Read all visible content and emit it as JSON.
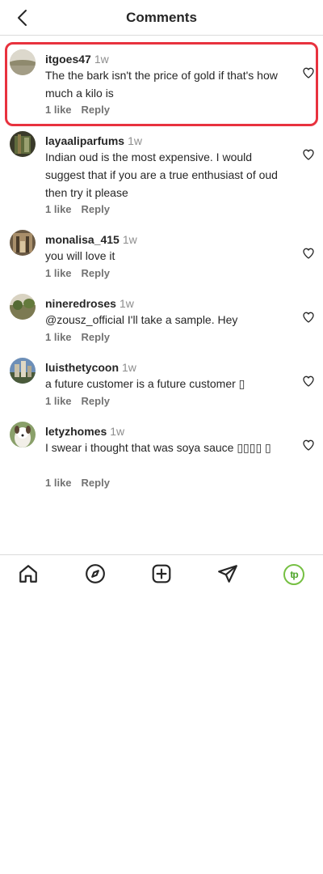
{
  "header": {
    "title": "Comments"
  },
  "comments": [
    {
      "username": "itgoes47",
      "time": "1w",
      "text": "The the bark isn't the price of gold if that's how much a kilo is",
      "likes": "1 like",
      "reply": "Reply"
    },
    {
      "username": "layaaliparfums",
      "time": "1w",
      "text": "Indian oud is the most expensive. I would suggest that if you are a true enthusiast of oud then try it please",
      "likes": "1 like",
      "reply": "Reply"
    },
    {
      "username": "monalisa_415",
      "time": "1w",
      "text": "you will love it",
      "likes": "1 like",
      "reply": "Reply"
    },
    {
      "username": "nineredroses",
      "time": "1w",
      "text": "@zousz_official I'll take a sample. Hey",
      "likes": "1 like",
      "reply": "Reply"
    },
    {
      "username": "luisthetycoon",
      "time": "1w",
      "text": "a future customer is a future customer ▯",
      "likes": "1 like",
      "reply": "Reply"
    },
    {
      "username": "letyzhomes",
      "time": "1w",
      "text": "I swear i thought that was soya sauce ▯▯▯▯ ▯",
      "likes": "1 like",
      "reply": "Reply"
    }
  ],
  "nav": {
    "profile_badge": "tp"
  },
  "colors": {
    "highlight": "#e8323e",
    "badge": "#76c043"
  }
}
